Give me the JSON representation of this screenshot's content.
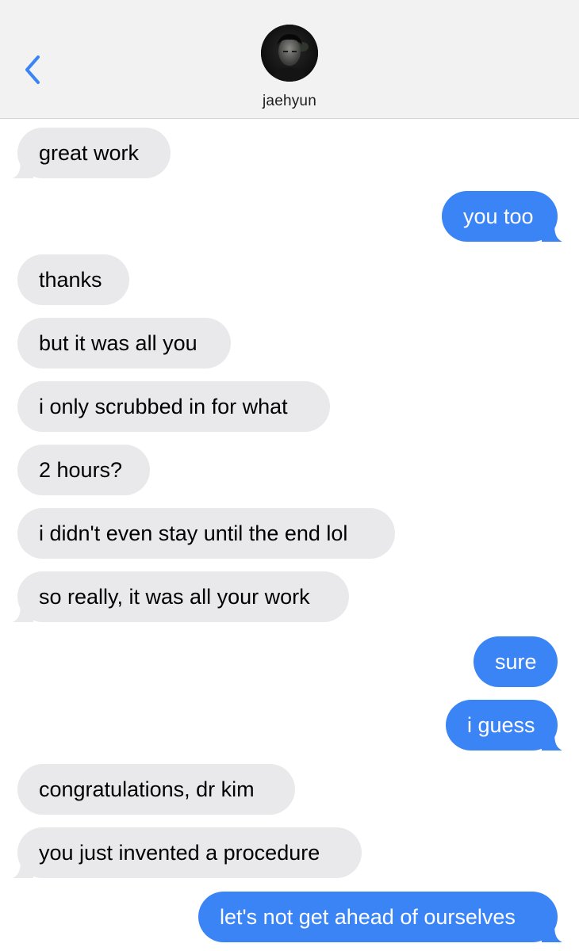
{
  "header": {
    "back_icon": "chevron-left-icon",
    "contact_name": "jaehyun",
    "avatar_icon": "contact-avatar-photo"
  },
  "colors": {
    "sent_bubble": "#3a84f5",
    "received_bubble": "#e9e9eb",
    "header_bg": "#f2f2f2",
    "accent": "#3a84f5"
  },
  "messages": [
    {
      "direction": "received",
      "text": "great work"
    },
    {
      "direction": "sent",
      "text": "you too"
    },
    {
      "direction": "received",
      "text": "thanks"
    },
    {
      "direction": "received",
      "text": "but it was all you"
    },
    {
      "direction": "received",
      "text": "i only scrubbed in for what"
    },
    {
      "direction": "received",
      "text": "2 hours?"
    },
    {
      "direction": "received",
      "text": "i didn't even stay until the end lol"
    },
    {
      "direction": "received",
      "text": "so really, it was all your work"
    },
    {
      "direction": "sent",
      "text": "sure"
    },
    {
      "direction": "sent",
      "text": "i guess"
    },
    {
      "direction": "received",
      "text": "congratulations, dr kim"
    },
    {
      "direction": "received",
      "text": "you just invented a procedure"
    },
    {
      "direction": "sent",
      "text": "let's not get ahead of ourselves"
    }
  ]
}
